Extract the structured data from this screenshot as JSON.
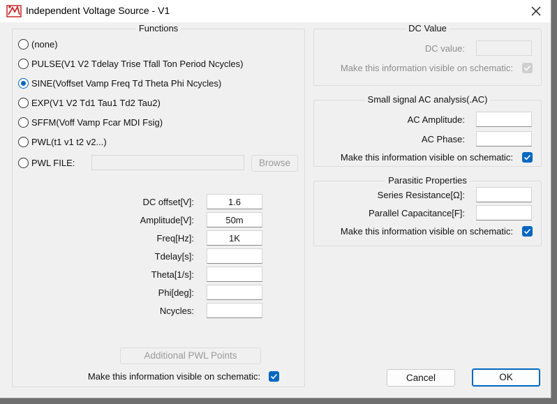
{
  "window": {
    "title": "Independent Voltage Source - V1"
  },
  "functions": {
    "title": "Functions",
    "options": [
      {
        "label": "(none)",
        "selected": false
      },
      {
        "label": "PULSE(V1 V2 Tdelay Trise Tfall Ton Period Ncycles)",
        "selected": false
      },
      {
        "label": "SINE(Voffset Vamp Freq Td Theta Phi Ncycles)",
        "selected": true
      },
      {
        "label": "EXP(V1 V2 Td1 Tau1 Td2 Tau2)",
        "selected": false
      },
      {
        "label": "SFFM(Voff Vamp Fcar MDI Fsig)",
        "selected": false
      },
      {
        "label": "PWL(t1 v1 t2 v2...)",
        "selected": false
      },
      {
        "label": "PWL FILE:",
        "selected": false
      }
    ],
    "pwl_file_value": "",
    "browse_label": "Browse",
    "params": [
      {
        "label": "DC offset[V]:",
        "value": "1.6"
      },
      {
        "label": "Amplitude[V]:",
        "value": "50m"
      },
      {
        "label": "Freq[Hz]:",
        "value": "1K"
      },
      {
        "label": "Tdelay[s]:",
        "value": ""
      },
      {
        "label": "Theta[1/s]:",
        "value": ""
      },
      {
        "label": "Phi[deg]:",
        "value": ""
      },
      {
        "label": "Ncycles:",
        "value": ""
      }
    ],
    "additional_pwl_label": "Additional PWL Points",
    "visible_label": "Make this information visible on schematic:",
    "visible_checked": true
  },
  "dc_value": {
    "title": "DC Value",
    "dc_label": "DC value:",
    "dc_value": "",
    "visible_label": "Make this information visible on schematic:",
    "visible_checked": true
  },
  "ac": {
    "title": "Small signal AC analysis(.AC)",
    "amplitude_label": "AC Amplitude:",
    "amplitude_value": "",
    "phase_label": "AC Phase:",
    "phase_value": "",
    "visible_label": "Make this information visible on schematic:",
    "visible_checked": true
  },
  "parasitic": {
    "title": "Parasitic Properties",
    "series_label": "Series Resistance[Ω]:",
    "series_value": "",
    "parallel_label": "Parallel Capacitance[F]:",
    "parallel_value": "",
    "visible_label": "Make this information visible on schematic:",
    "visible_checked": true
  },
  "buttons": {
    "cancel": "Cancel",
    "ok": "OK"
  },
  "colors": {
    "accent": "#0067c0",
    "dialog_bg": "#f0f0f0"
  },
  "icons": {
    "app": "ltspice-app-icon",
    "close": "close-icon",
    "check": "checkmark-icon"
  }
}
